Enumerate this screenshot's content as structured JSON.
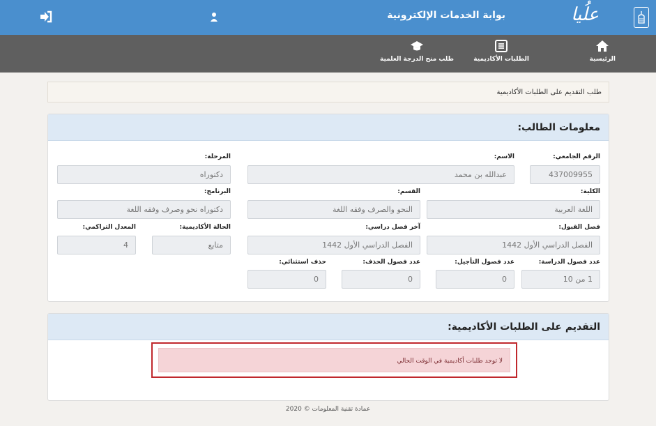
{
  "header": {
    "logo_text": "علُيا",
    "portal_title": "بوابة الخدمات الإلكترونية",
    "icons": [
      "university-logo-icon",
      "user-icon",
      "logout-icon"
    ],
    "color": "#4a8fce"
  },
  "nav": {
    "color": "#5f5f5f",
    "items": [
      {
        "label": "الرئيسية",
        "icon": "home-icon"
      },
      {
        "label": "الطلبات الأكاديمية",
        "icon": "list-icon"
      },
      {
        "label": "طلب منح الدرجة العلمية",
        "icon": "graduation-cap-icon"
      }
    ]
  },
  "breadcrumb": "طلب التقديم على الطلبات الأكاديمية",
  "student_info": {
    "title": "معلومات الطالب:",
    "fields": {
      "student_id": {
        "label": "الرقم الجامعي:",
        "value": "437009955"
      },
      "name": {
        "label": "الاسم:",
        "value": "عبدالله بن محمد"
      },
      "level": {
        "label": "المرحلة:",
        "value": "دكتوراه"
      },
      "college": {
        "label": "الكلية:",
        "value": "اللغة العربية"
      },
      "department": {
        "label": "القسم:",
        "value": "النحو والصرف وفقه اللغة"
      },
      "program": {
        "label": "البرنامج:",
        "value": "دكتوراه نحو وصرف وفقه اللغة"
      },
      "admission_term": {
        "label": "فصل القبول:",
        "value": "الفصل الدراسي الأول 1442"
      },
      "last_term": {
        "label": "آخر فصل دراسي:",
        "value": "الفصل الدراسي الأول 1442"
      },
      "academic_status": {
        "label": "الحالة الأكاديمية:",
        "value": "متابع"
      },
      "gpa": {
        "label": "المعدل التراكمي:",
        "value": "4"
      },
      "study_terms": {
        "label": "عدد فصول الدراسة:",
        "value": "1 من 10"
      },
      "postponed_terms": {
        "label": "عدد فصول التأجيل:",
        "value": "0"
      },
      "dropped_terms": {
        "label": "عدد فصول الحذف:",
        "value": "0"
      },
      "exceptional_drop": {
        "label": "حذف استثنائي:",
        "value": "0"
      }
    }
  },
  "apply": {
    "title": "التقديم على الطلبات الأكاديمية:",
    "alert": "لا توجد طلبات أكاديمية في الوقت الحالي",
    "alert_color": "#f5d4d7",
    "highlight_color": "#c0282d"
  },
  "footer": "عمادة تقنية المعلومات © 2020"
}
